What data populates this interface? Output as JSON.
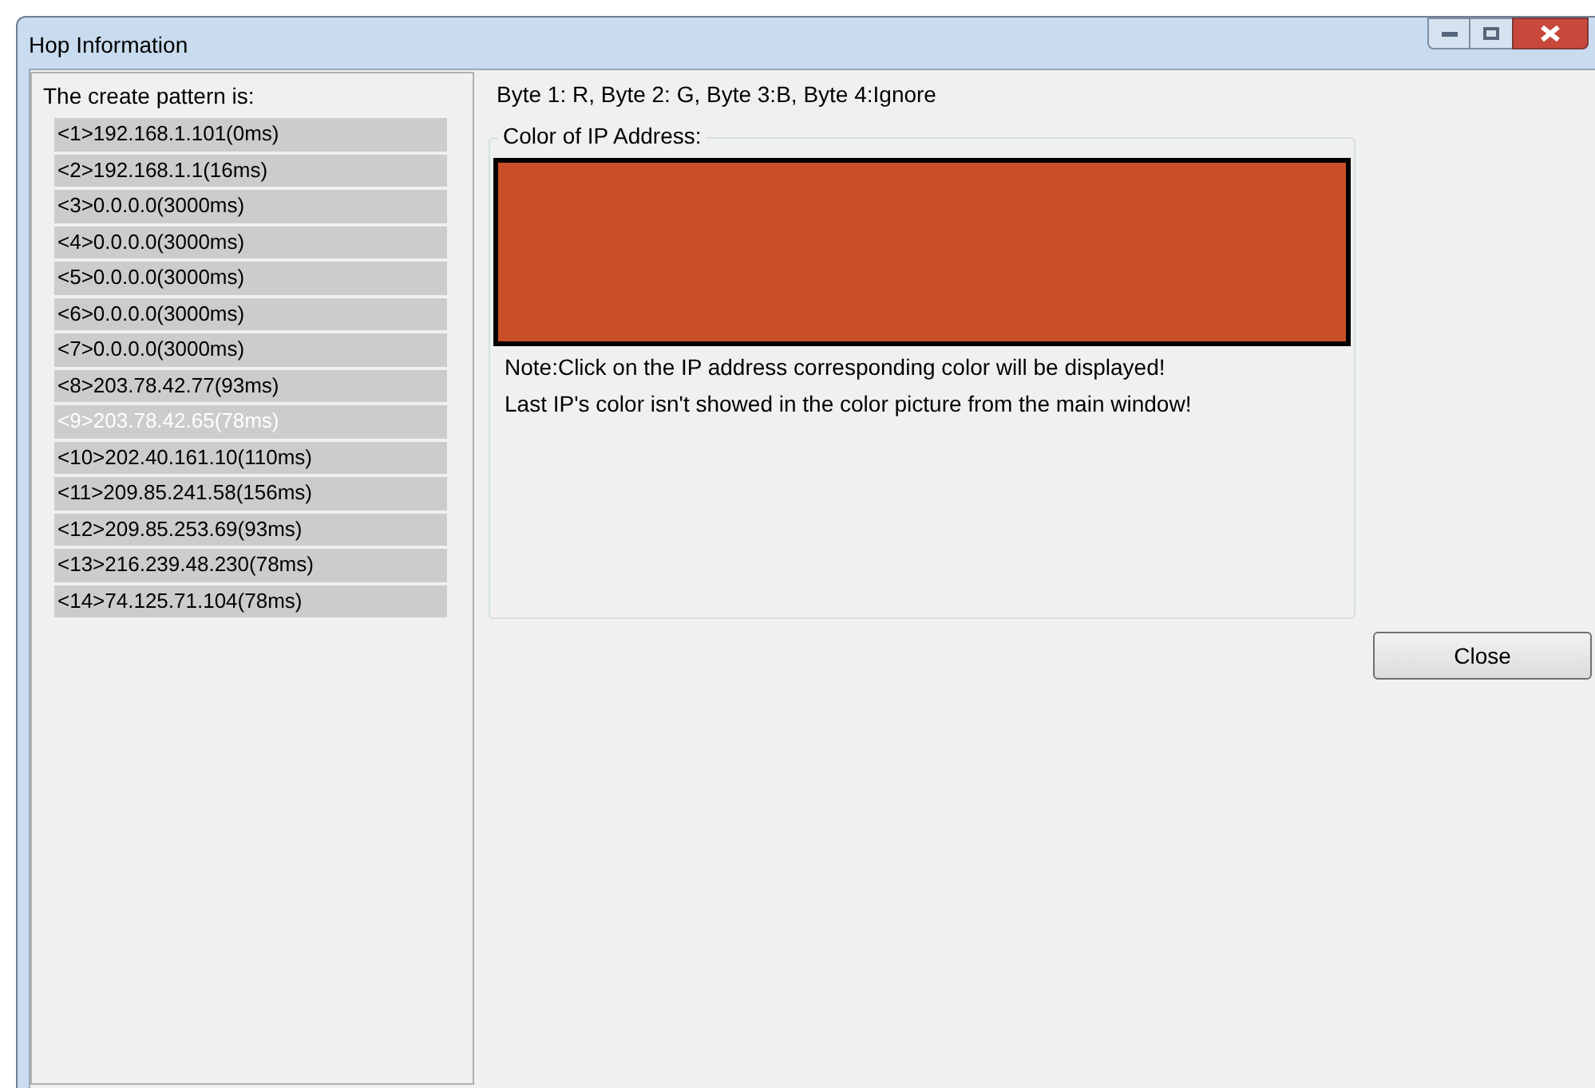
{
  "window": {
    "title": "Hop Information"
  },
  "pattern_label": "The create pattern is:",
  "hops": [
    {
      "label": "<1>192.168.1.101(0ms)",
      "selected": false
    },
    {
      "label": "<2>192.168.1.1(16ms)",
      "selected": false
    },
    {
      "label": "<3>0.0.0.0(3000ms)",
      "selected": false
    },
    {
      "label": "<4>0.0.0.0(3000ms)",
      "selected": false
    },
    {
      "label": "<5>0.0.0.0(3000ms)",
      "selected": false
    },
    {
      "label": "<6>0.0.0.0(3000ms)",
      "selected": false
    },
    {
      "label": "<7>0.0.0.0(3000ms)",
      "selected": false
    },
    {
      "label": "<8>203.78.42.77(93ms)",
      "selected": false
    },
    {
      "label": "<9>203.78.42.65(78ms)",
      "selected": true
    },
    {
      "label": "<10>202.40.161.10(110ms)",
      "selected": false
    },
    {
      "label": "<11>209.85.241.58(156ms)",
      "selected": false
    },
    {
      "label": "<12>209.85.253.69(93ms)",
      "selected": false
    },
    {
      "label": "<13>216.239.48.230(78ms)",
      "selected": false
    },
    {
      "label": "<14>74.125.71.104(78ms)",
      "selected": false
    }
  ],
  "byte_legend": "Byte 1: R, Byte 2: G, Byte 3:B, Byte 4:Ignore",
  "color_group": {
    "title": "Color of IP Address:",
    "color": "#c94f2a",
    "notes": [
      "Note:Click on the IP address corresponding color will be displayed!",
      "Last IP's color isn't showed in the color picture from the main window!"
    ]
  },
  "buttons": [
    {
      "label": "Close"
    }
  ]
}
